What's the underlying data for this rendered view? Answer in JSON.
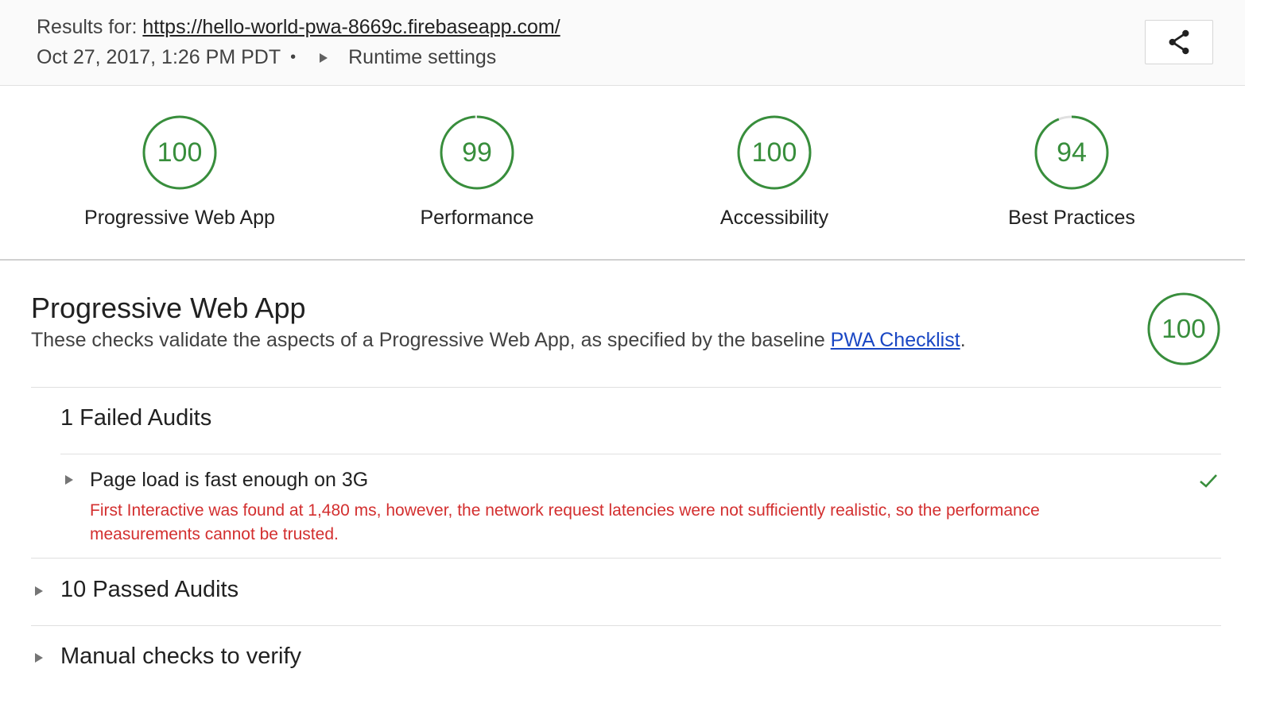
{
  "header": {
    "results_prefix": "Results for:",
    "url": "https://hello-world-pwa-8669c.firebaseapp.com/",
    "timestamp": "Oct 27, 2017, 1:26 PM PDT",
    "separator": "•",
    "runtime_settings": "Runtime settings",
    "share_icon": "share-icon"
  },
  "scores": [
    {
      "value": "100",
      "label": "Progressive Web App",
      "fraction": 1.0
    },
    {
      "value": "99",
      "label": "Performance",
      "fraction": 0.99
    },
    {
      "value": "100",
      "label": "Accessibility",
      "fraction": 1.0
    },
    {
      "value": "94",
      "label": "Best Practices",
      "fraction": 0.94
    }
  ],
  "section": {
    "title": "Progressive Web App",
    "description": "These checks validate the aspects of a Progressive Web App, as specified by the baseline ",
    "link_text": "PWA Checklist",
    "period": ".",
    "score": "100",
    "score_fraction": 1.0
  },
  "failed": {
    "title": "1 Failed Audits",
    "audit": {
      "title": "Page load is fast enough on 3G",
      "error": "First Interactive was found at 1,480 ms, however, the network request latencies were not sufficiently realistic, so the performance measurements cannot be trusted.",
      "status_icon": "checkmark-icon"
    }
  },
  "passed": {
    "title": "10 Passed Audits"
  },
  "manual": {
    "title": "Manual checks to verify"
  },
  "colors": {
    "pass": "#388e3c",
    "track": "#e0e0e0",
    "error": "#d32f2f",
    "link": "#1a47c4"
  }
}
